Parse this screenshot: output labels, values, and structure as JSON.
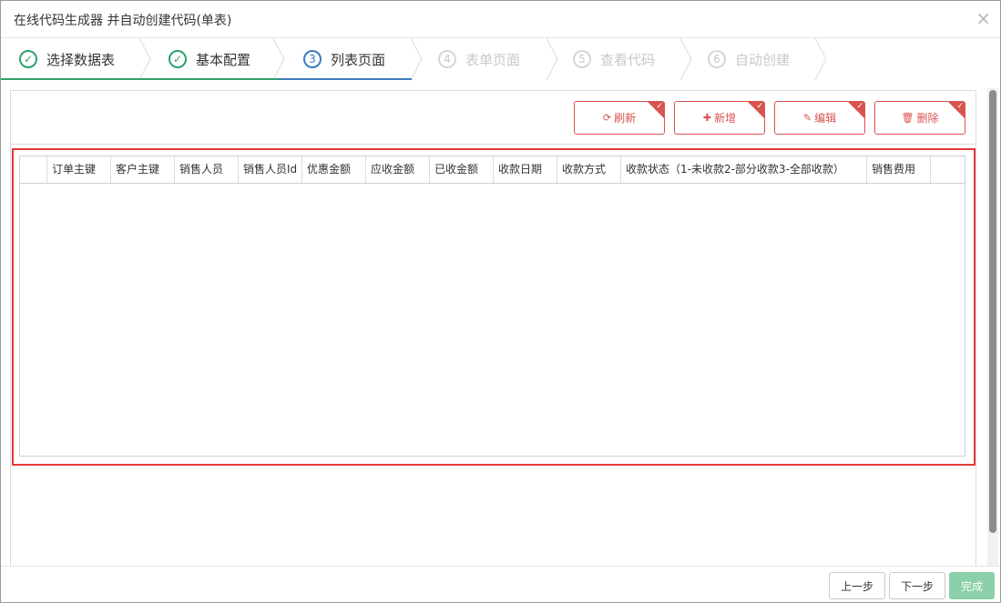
{
  "window": {
    "title": "在线代码生成器 并自动创建代码(单表)",
    "close_glyph": "×"
  },
  "steps": [
    {
      "number": "✓",
      "label": "选择数据表",
      "state": "done"
    },
    {
      "number": "✓",
      "label": "基本配置",
      "state": "done"
    },
    {
      "number": "3",
      "label": "列表页面",
      "state": "active"
    },
    {
      "number": "4",
      "label": "表单页面",
      "state": "todo"
    },
    {
      "number": "5",
      "label": "查看代码",
      "state": "todo"
    },
    {
      "number": "6",
      "label": "自动创建",
      "state": "todo"
    }
  ],
  "toolbar": {
    "refresh_label": "刷新",
    "add_label": "新增",
    "edit_label": "编辑",
    "delete_label": "删除"
  },
  "grid": {
    "columns": [
      "",
      "订单主键",
      "客户主键",
      "销售人员",
      "销售人员Id",
      "优惠金额",
      "应收金额",
      "已收金额",
      "收款日期",
      "收款方式",
      "收款状态（1-未收款2-部分收款3-全部收款）",
      "销售费用",
      ""
    ]
  },
  "footer": {
    "prev_label": "上一步",
    "next_label": "下一步",
    "finish_label": "完成"
  },
  "colors": {
    "done": "#2fa26b",
    "active": "#3c7bbd",
    "todo": "#c8c8c8",
    "danger": "#d9534f",
    "highlight": "#e23a3a",
    "finish": "#8bd0a8"
  }
}
